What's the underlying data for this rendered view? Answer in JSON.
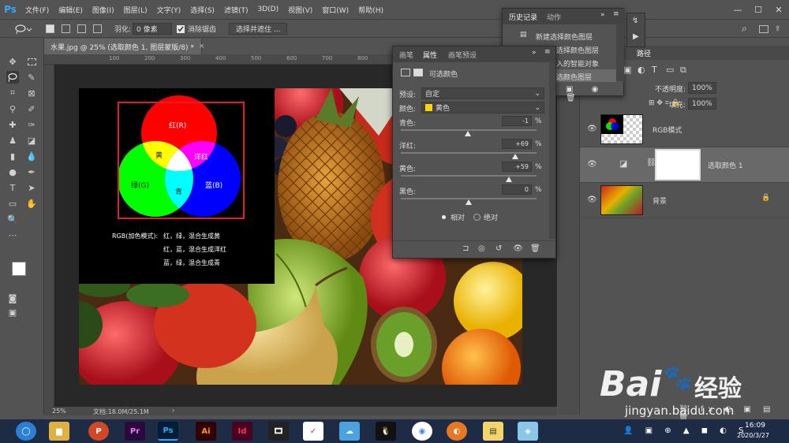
{
  "menubar": {
    "logo": "Ps",
    "items": [
      "文件(F)",
      "编辑(E)",
      "图像(I)",
      "图层(L)",
      "文字(Y)",
      "选择(S)",
      "滤镜(T)",
      "3D(D)",
      "视图(V)",
      "窗口(W)",
      "帮助(H)"
    ],
    "min": "—",
    "max": "☐",
    "close": "✕"
  },
  "options": {
    "feather_label": "羽化:",
    "feather_value": "0 像素",
    "antialias_label": "消除锯齿",
    "select_mask_button": "选择并遮住 ..."
  },
  "document": {
    "tab_title": "水果.jpg @ 25% (选取颜色 1, 图层蒙版/8) *",
    "tab_close": "×",
    "zoom": "25%",
    "doc_info": "文档:18.0M/25.1M",
    "ruler_labels": [
      "100",
      "200",
      "300",
      "400",
      "500",
      "600",
      "700",
      "800",
      "900",
      "1000",
      "1100",
      "1200",
      "1300"
    ]
  },
  "rgb_diagram": {
    "red": "红(R)",
    "green": "绿(G)",
    "blue": "蓝(B)",
    "yellow": "黄",
    "magenta": "洋红",
    "cyan": "青",
    "mode_label": "RGB(加色模式):",
    "lines": [
      "红，绿，混合生成黄",
      "红，蓝，混合生成洋红",
      "蓝，绿，混合生成青"
    ]
  },
  "history": {
    "tabs": [
      "历史记录",
      "动作"
    ],
    "items": [
      "新建选择颜色图层",
      "选择颜色图层",
      "入的智能对象",
      "选颜色图层"
    ]
  },
  "properties": {
    "tabs": [
      "画笔",
      "属性",
      "画笔预设"
    ],
    "title": "可选颜色",
    "preset_label": "预设:",
    "preset_value": "自定",
    "colors_label": "颜色:",
    "colors_value": "黄色",
    "sliders": [
      {
        "label": "青色:",
        "value": "-1",
        "unit": "%",
        "level": -1
      },
      {
        "label": "洋红:",
        "value": "+69",
        "unit": "%",
        "level": 69
      },
      {
        "label": "黄色:",
        "value": "+59",
        "unit": "%",
        "level": 59
      },
      {
        "label": "黑色:",
        "value": "0",
        "unit": "%",
        "level": 0
      }
    ],
    "relative": "相对",
    "absolute": "绝对"
  },
  "right_panel": {
    "path_tab": "路径",
    "blend_label": "校正",
    "opacity_label": "不透明度:",
    "opacity_value": "100%",
    "fill_label": "填充:",
    "fill_value": "100%"
  },
  "layers": [
    {
      "name": "RGB模式"
    },
    {
      "name": "选取颜色 1"
    },
    {
      "name": "背景"
    }
  ],
  "taskbar": {
    "icons": [
      "Pr",
      "Pr",
      "Ps",
      "Ai",
      "Id"
    ],
    "time": "16:09",
    "date": "2020/3/27"
  },
  "watermark": {
    "brand": "Bai",
    "cn": "经验",
    "url": "jingyan.baidu.com"
  },
  "colors": {
    "accent_ps": "#31a8ff",
    "panel": "#535353",
    "selection_red": "#e21e26"
  }
}
